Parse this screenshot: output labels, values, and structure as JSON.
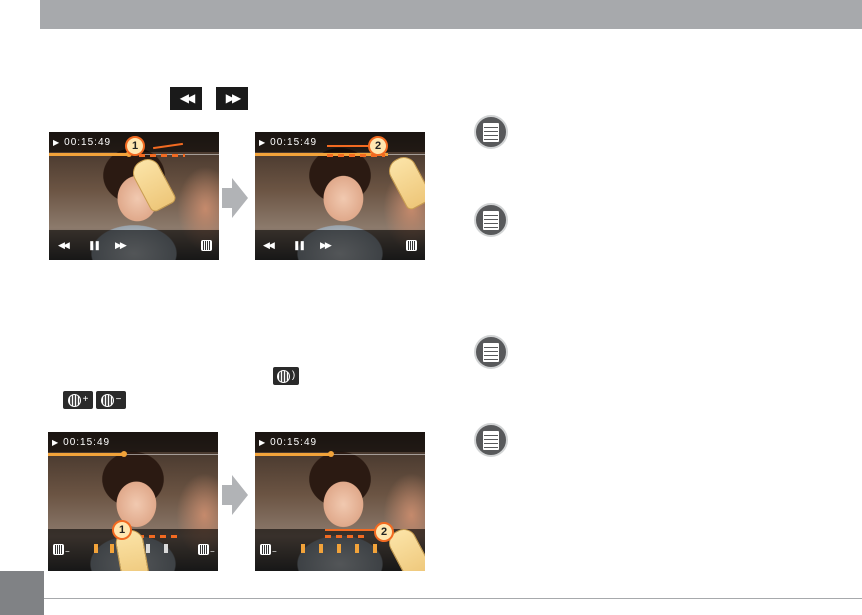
{
  "colors": {
    "header_band": "#a7a9ac",
    "page_tab": "#808285",
    "accent_orange": "#f26a21",
    "progress_yellow": "#f2a33a",
    "note_icon": "#58595b"
  },
  "icons": {
    "rewind_button": {
      "glyph": "◀◀"
    },
    "fast_forward_button": {
      "glyph": "▶▶"
    },
    "volume_button": {
      "name": "volume-icon"
    },
    "volume_plus": {
      "name": "volume-up-icon",
      "sign": "+"
    },
    "volume_minus": {
      "name": "volume-down-icon",
      "sign": "−"
    },
    "note": {
      "name": "note-icon"
    }
  },
  "figures": {
    "seek_before": {
      "timecode": "00:15:49",
      "step": "1",
      "progress": 0.47
    },
    "seek_after": {
      "timecode": "00:15:49",
      "step": "2",
      "progress": 0.79
    },
    "volume_before": {
      "timecode": "00:15:49",
      "step": "1",
      "progress": 0.45
    },
    "volume_after": {
      "timecode": "00:15:49",
      "step": "2",
      "progress": 0.45
    }
  },
  "player_controls": {
    "rewind": "◀◀",
    "pause": "❚❚",
    "forward": "▶▶",
    "vol_minus": "−",
    "vol_plus": "−"
  }
}
